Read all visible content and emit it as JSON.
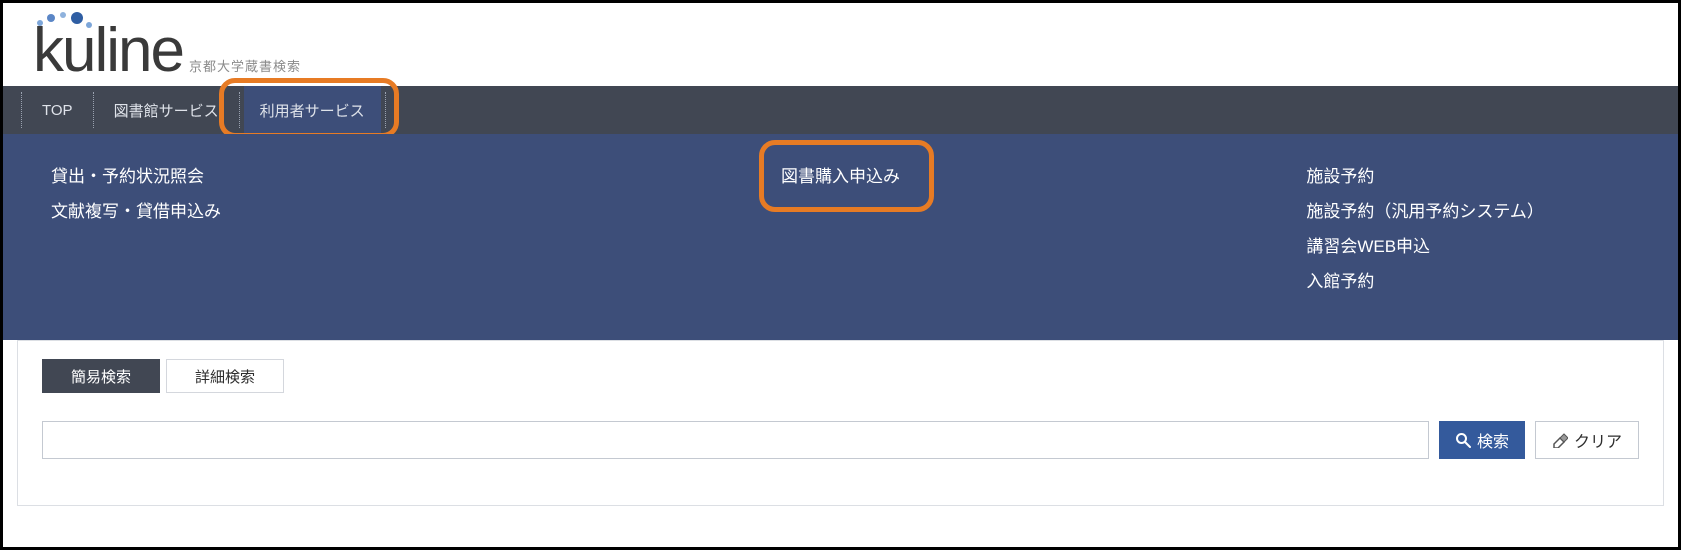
{
  "logo": {
    "text": "kuline",
    "sub": "京都大学蔵書検索"
  },
  "nav": {
    "items": [
      "TOP",
      "図書館サービス",
      "利用者サービス"
    ],
    "active_index": 2
  },
  "mega": {
    "left": [
      "貸出・予約状況照会",
      "文献複写・貸借申込み"
    ],
    "mid": [
      "図書購入申込み"
    ],
    "right": [
      "施設予約",
      "施設予約（汎用予約システム）",
      "講習会WEB申込",
      "入館予約"
    ]
  },
  "search": {
    "tabs": {
      "simple": "簡易検索",
      "advanced": "詳細検索",
      "active": "simple"
    },
    "query": "",
    "placeholder": "",
    "search_button": "検索",
    "clear_button": "クリア"
  },
  "colors": {
    "nav_bg": "#414753",
    "panel_bg": "#3d4e79",
    "highlight": "#e77b24",
    "search_btn": "#345a9c"
  }
}
